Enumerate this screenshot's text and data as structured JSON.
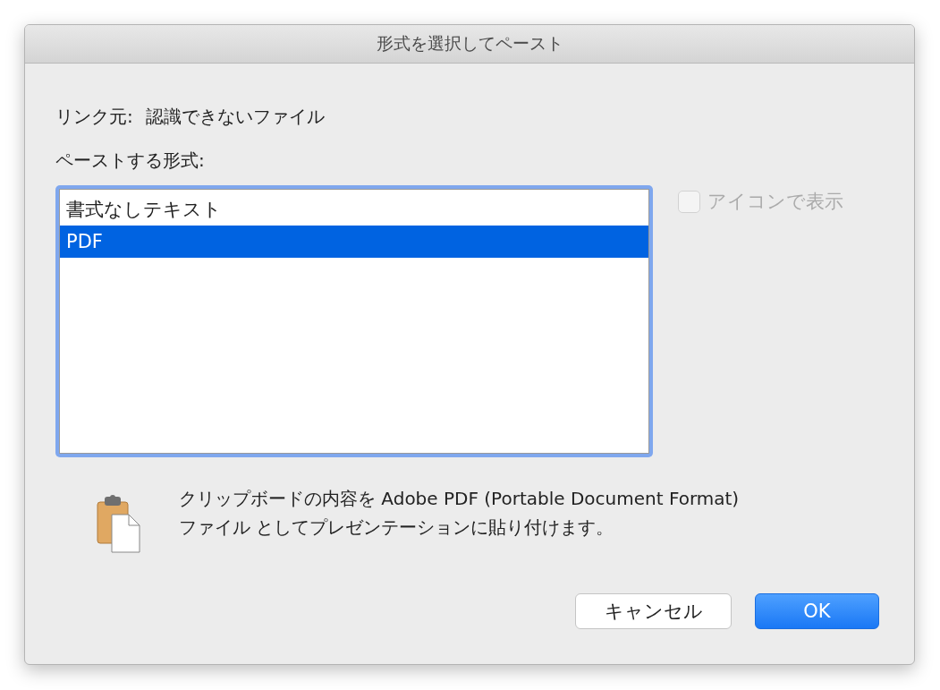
{
  "window": {
    "title": "形式を選択してペースト"
  },
  "source": {
    "label": "リンク元:",
    "value": "認識できないファイル"
  },
  "format_label": "ペーストする形式:",
  "formats": [
    {
      "label": "書式なしテキスト",
      "selected": false
    },
    {
      "label": "PDF",
      "selected": true
    }
  ],
  "display_as_icon": {
    "label": "アイコンで表示",
    "checked": false,
    "disabled": true
  },
  "description": "クリップボードの内容を Adobe PDF (Portable Document Format)\nファイル としてプレゼンテーションに貼り付けます。",
  "buttons": [
    {
      "label": "キャンセル",
      "default": false
    },
    {
      "label": "OK",
      "default": true
    }
  ]
}
